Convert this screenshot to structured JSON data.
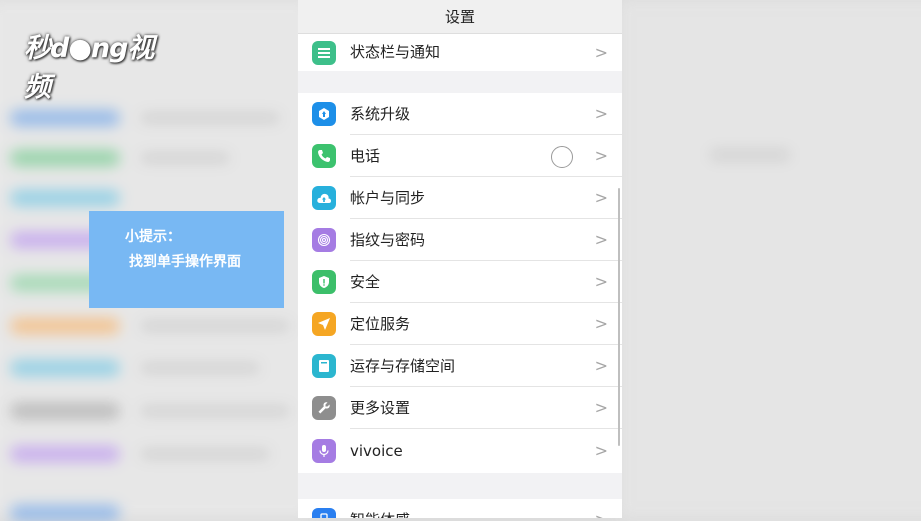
{
  "watermark": "秒d●ng视频",
  "header": {
    "title": "设置"
  },
  "tip": {
    "line1": "小提示：",
    "line2": "找到单手操作界面"
  },
  "colors": {
    "status_bar_icon": "#3dbf8a",
    "upgrade_icon": "#1d8fe8",
    "phone_icon": "#3cc26e",
    "account_icon": "#27b0dc",
    "fingerprint_icon": "#a57ce3",
    "security_icon": "#3cbf6a",
    "location_icon": "#f5a623",
    "storage_icon": "#2bb6cf",
    "more_icon": "#8e8e8e",
    "vivoice_icon": "#a57ce3",
    "smart_icon": "#2a7ff0",
    "tip_background": "#78b8f3"
  },
  "settings": {
    "items": [
      {
        "label": "状态栏与通知",
        "icon": "list-icon"
      },
      {
        "label": "系统升级",
        "icon": "upgrade-icon"
      },
      {
        "label": "电话",
        "icon": "phone-icon"
      },
      {
        "label": "帐户与同步",
        "icon": "cloud-icon"
      },
      {
        "label": "指纹与密码",
        "icon": "fingerprint-icon"
      },
      {
        "label": "安全",
        "icon": "shield-icon"
      },
      {
        "label": "定位服务",
        "icon": "location-icon"
      },
      {
        "label": "运存与存储空间",
        "icon": "storage-icon"
      },
      {
        "label": "更多设置",
        "icon": "wrench-icon"
      },
      {
        "label": "vivoice",
        "icon": "microphone-icon"
      },
      {
        "label": "智能体感",
        "icon": "smart-motion-icon"
      }
    ],
    "chevron": ">"
  }
}
